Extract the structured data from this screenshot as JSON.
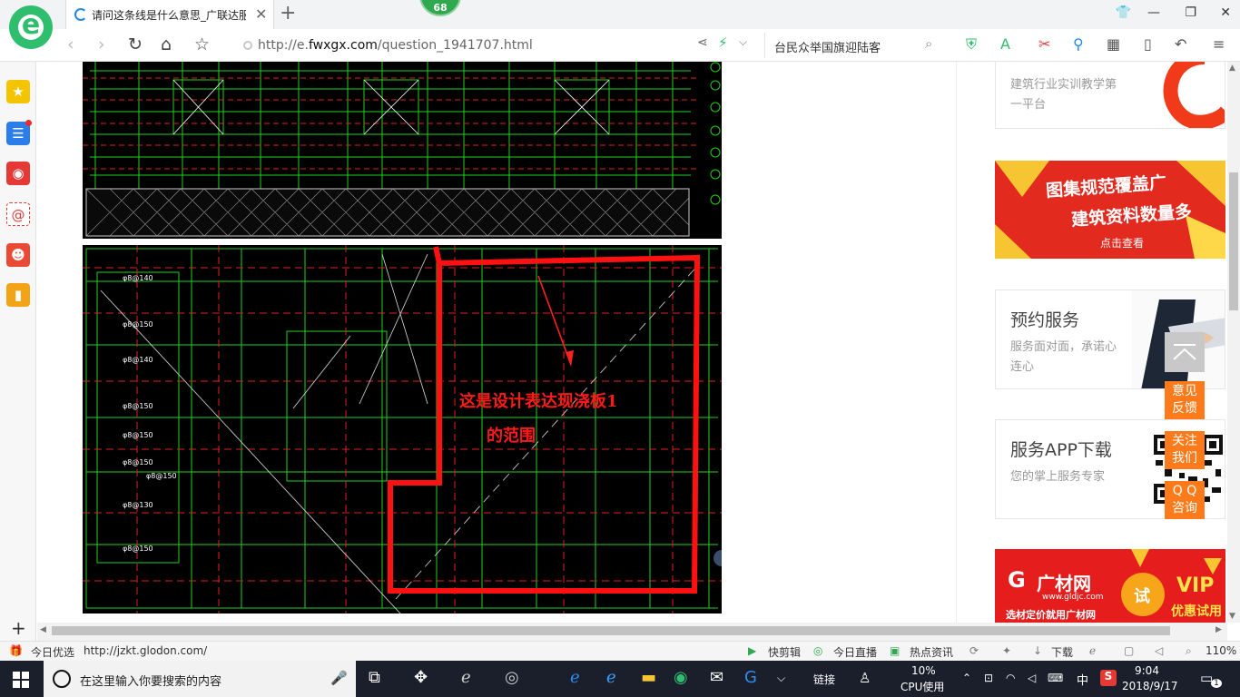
{
  "browser": {
    "tab_title": "请问这条线是什么意思_广联达服",
    "badge_count": "68",
    "url_host": "http://e.",
    "url_domain": "fwxgx.com",
    "url_path": "/question_1941707.html",
    "search_query": "台民众举国旗迎陆客"
  },
  "content": {
    "annotation_line1": "这是设计表达现浇板1",
    "annotation_line2": "的范围",
    "cad_labels": [
      "φ8@140",
      "φ8@150",
      "φ8@140",
      "φ8@150",
      "φ8@150",
      "φ8@150",
      "φ8@130",
      "φ8@150",
      "φ8@150"
    ]
  },
  "sidebar_right": {
    "card1_desc": "建筑行业实训教学第一平台",
    "banner1_line1": "图集规范覆盖广",
    "banner1_line2": "建筑资料数量多",
    "banner1_button": "点击查看",
    "card2_title": "预约服务",
    "card2_desc": "服务面对面，承诺心连心",
    "card3_title": "服务APP下载",
    "card3_desc": "您的掌上服务专家",
    "banner2_brand": "广材网",
    "banner2_site": "www.gldjc.com",
    "banner2_try": "试",
    "banner2_vip": "VIP",
    "banner2_vip_sub": "优惠试用",
    "banner2_tagline": "选材定价就用广材网"
  },
  "floating": {
    "feedback": "意见\n反馈",
    "follow": "关注\n我们",
    "qq": "Q Q\n咨询"
  },
  "statusbar": {
    "daily_pick": "今日优选",
    "link": "http://jzkt.glodon.com/",
    "quick_clip": "快剪辑",
    "live": "今日直播",
    "hot_news": "热点资讯",
    "download": "下载",
    "zoom": "110%"
  },
  "taskbar": {
    "search_placeholder": "在这里输入你要搜索的内容",
    "links": "链接",
    "cpu_percent": "10%",
    "cpu_label": "CPU使用",
    "ime": "中",
    "time": "9:04",
    "date": "2018/9/17",
    "notif_count": "1"
  }
}
